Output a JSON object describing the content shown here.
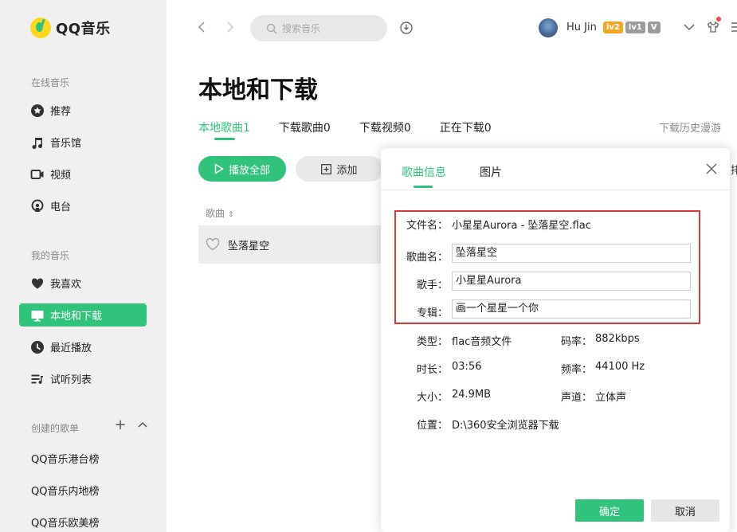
{
  "app": {
    "logo_text": "QQ音乐"
  },
  "sidebar": {
    "online_title": "在线音乐",
    "online_items": [
      {
        "label": "推荐",
        "icon": "star-icon"
      },
      {
        "label": "音乐馆",
        "icon": "music-note-icon"
      },
      {
        "label": "视频",
        "icon": "video-icon"
      },
      {
        "label": "电台",
        "icon": "radio-icon"
      }
    ],
    "mine_title": "我的音乐",
    "mine_items": [
      {
        "label": "我喜欢",
        "icon": "heart-icon"
      },
      {
        "label": "本地和下载",
        "icon": "monitor-icon",
        "active": true
      },
      {
        "label": "最近播放",
        "icon": "clock-icon"
      },
      {
        "label": "试听列表",
        "icon": "playlist-icon"
      }
    ],
    "created_title": "创建的歌单",
    "playlists": [
      "QQ音乐港台榜",
      "QQ音乐内地榜",
      "QQ音乐欧美榜"
    ]
  },
  "topbar": {
    "search_placeholder": "搜索音乐",
    "username": "Hu Jin",
    "badges": [
      {
        "text": "lv2",
        "color": "#f5a623"
      },
      {
        "text": "lv1",
        "color": "#9b9b9b"
      },
      {
        "text": "V",
        "color": "#9b9b9b"
      }
    ]
  },
  "main": {
    "title": "本地和下载",
    "tabs": [
      {
        "label": "本地歌曲1",
        "active": true
      },
      {
        "label": "下载歌曲0"
      },
      {
        "label": "下载视频0"
      },
      {
        "label": "正在下载0"
      }
    ],
    "history_link": "下载历史漫游",
    "play_all": "播放全部",
    "add": "添加",
    "column_song": "歌曲",
    "songs": [
      {
        "title": "坠落星空"
      }
    ],
    "partial_text": "排"
  },
  "dialog": {
    "tabs": [
      {
        "label": "歌曲信息",
        "active": true
      },
      {
        "label": "图片"
      }
    ],
    "filename_label": "文件名：",
    "filename": "小星星Aurora - 坠落星空.flac",
    "title_label": "歌曲名：",
    "title_value": "坠落星空",
    "artist_label": "歌手：",
    "artist_value": "小星星Aurora",
    "album_label": "专辑：",
    "album_value": "画一个星星一个你",
    "type_label": "类型：",
    "type_value": "flac音频文件",
    "bitrate_label": "码率：",
    "bitrate_value": "882kbps",
    "duration_label": "时长：",
    "duration_value": "03:56",
    "frequency_label": "频率：",
    "frequency_value": "44100 Hz",
    "size_label": "大小：",
    "size_value": "24.9MB",
    "channel_label": "声道：",
    "channel_value": "立体声",
    "location_label": "位置：",
    "location_value": "D:\\360安全浏览器下载",
    "ok": "确定",
    "cancel": "取消"
  },
  "colors": {
    "accent": "#31c27c",
    "highlight": "#d63a3a"
  }
}
